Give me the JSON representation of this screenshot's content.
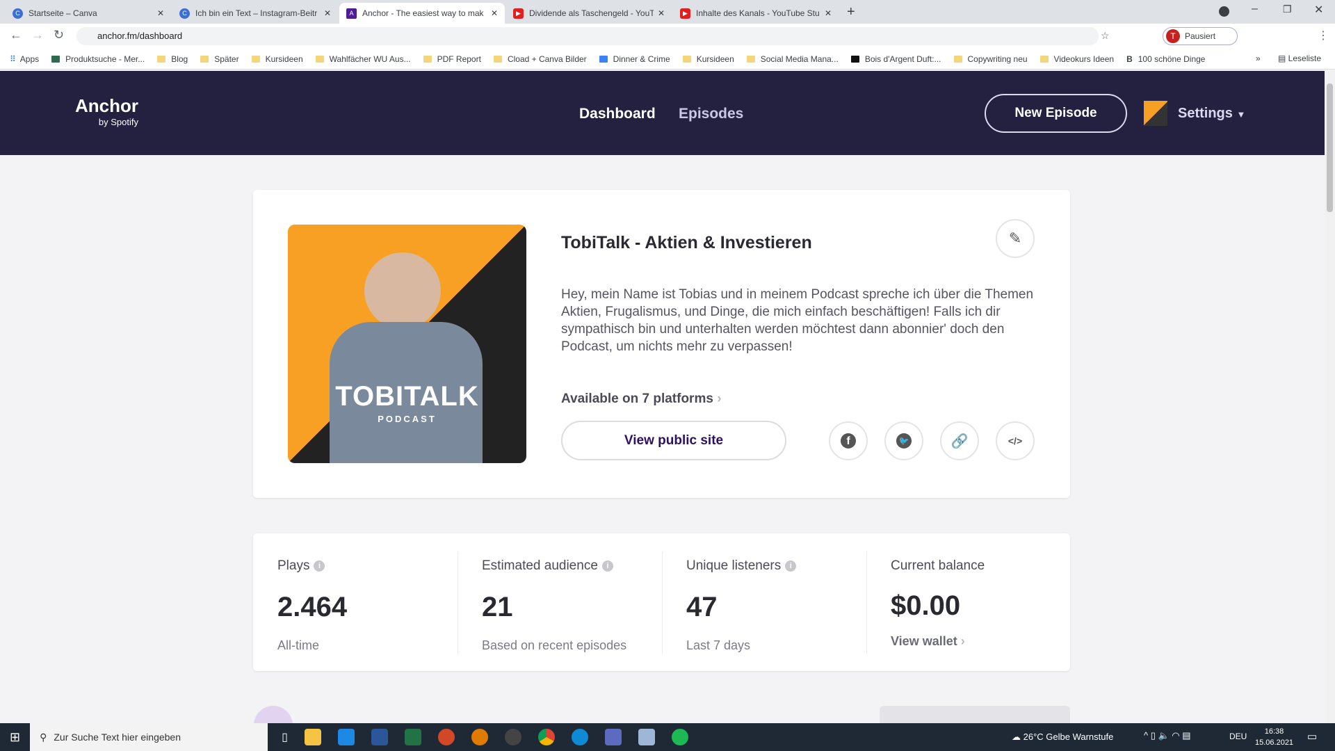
{
  "browser": {
    "tabs": [
      {
        "title": "Startseite – Canva",
        "color": "#3b6fd4",
        "glyph": "C"
      },
      {
        "title": "Ich bin ein Text – Instagram-Beitr",
        "color": "#3b6fd4",
        "glyph": "C"
      },
      {
        "title": "Anchor - The easiest way to mak",
        "color": "#4c1d95",
        "glyph": "A"
      },
      {
        "title": "Dividende als Taschengeld - YouT",
        "color": "#e02020",
        "glyph": "▶"
      },
      {
        "title": "Inhalte des Kanals - YouTube Stu",
        "color": "#e02020",
        "glyph": "▶"
      }
    ],
    "new_tab": "+",
    "url": "anchor.fm/dashboard",
    "profile_label": "Pausiert",
    "profile_initial": "T",
    "bookmarks": [
      "Apps",
      "Produktsuche - Mer...",
      "Blog",
      "Später",
      "Kursideen",
      "Wahlfächer WU Aus...",
      "PDF Report",
      "Cload + Canva Bilder",
      "Dinner & Crime",
      "Kursideen",
      "Social Media Mana...",
      "Bois d'Argent Duft:...",
      "Copywriting neu",
      "Videokurs Ideen",
      "100 schöne Dinge"
    ],
    "more_bookmarks": "»",
    "reading_list": "Leseliste"
  },
  "header": {
    "logo": "Anchor",
    "logo_sub": "by Spotify",
    "nav": [
      "Dashboard",
      "Episodes"
    ],
    "new_episode": "New Episode",
    "settings": "Settings"
  },
  "podcast": {
    "cover_title": "TOBITALK",
    "cover_sub": "PODCAST",
    "title": "TobiTalk - Aktien & Investieren",
    "description": "Hey, mein Name ist Tobias und in meinem Podcast spreche ich über die Themen Aktien, Frugalismus, und Dinge, die mich einfach beschäftigen! Falls ich dir sympathisch bin und unterhalten werden möchtest dann abonnier' doch den Podcast, um nichts mehr zu verpassen!",
    "platforms": "Available on 7 platforms",
    "view_public": "View public site"
  },
  "stats": [
    {
      "label": "Plays",
      "value": "2.464",
      "sub": "All-time",
      "info": true
    },
    {
      "label": "Estimated audience",
      "value": "21",
      "sub": "Based on recent episodes",
      "info": true
    },
    {
      "label": "Unique listeners",
      "value": "47",
      "sub": "Last 7 days",
      "info": true
    },
    {
      "label": "Current balance",
      "value": "$0.00",
      "sub": "View wallet",
      "info": false
    }
  ],
  "taskbar": {
    "search": "Zur Suche Text hier eingeben",
    "weather": "26°C  Gelbe Warnstufe",
    "lang": "DEU",
    "time": "16:38",
    "date": "15.06.2021"
  },
  "colors": {
    "header": "#232040",
    "accent": "#4c1d95",
    "cover_orange": "#f7a023"
  }
}
